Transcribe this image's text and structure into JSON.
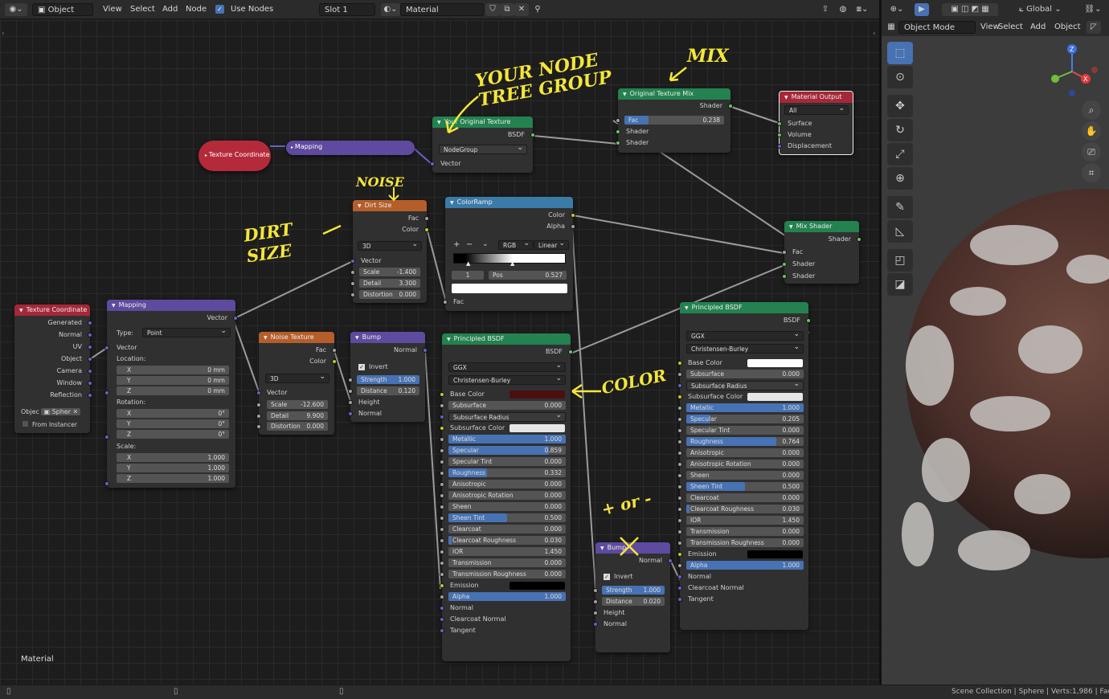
{
  "topbar": {
    "mode": "Object",
    "menus": [
      "View",
      "Select",
      "Add",
      "Node"
    ],
    "use_nodes_label": "Use Nodes",
    "slot": "Slot 1",
    "material": "Material"
  },
  "viewport_topbar": {
    "orientation": "Global"
  },
  "viewport_header": {
    "mode": "Object Mode",
    "menus": [
      "View",
      "Select",
      "Add",
      "Object"
    ]
  },
  "editor": {
    "material_label": "Material"
  },
  "status": {
    "text": "Scene Collection | Sphere | Verts:1,986 | Face"
  },
  "annotations": {
    "group": "YOUR NODE TREE GROUP",
    "mix": "MIX",
    "noise": "NOISE",
    "dirt": "DIRT SIZE",
    "color": "COLOR",
    "plusminus": "+ or -"
  },
  "nodes": {
    "tex_coord_collapsed": {
      "title": "Texture Coordinate"
    },
    "mapping_collapsed": {
      "title": "Mapping"
    },
    "your_texture": {
      "title": "Your Original Texture",
      "out": "BSDF",
      "group": "NodeGroup",
      "in": "Vector"
    },
    "orig_mix": {
      "title": "Original Texture Mix",
      "out": "Shader",
      "fac_label": "Fac",
      "fac": "0.238",
      "in1": "Shader",
      "in2": "Shader"
    },
    "mat_output": {
      "title": "Material Output",
      "target": "All",
      "in": [
        "Surface",
        "Volume",
        "Displacement"
      ]
    },
    "dirt_size": {
      "title": "Dirt Size",
      "outs": [
        "Fac",
        "Color"
      ],
      "dim": "3D",
      "vector": "Vector",
      "scale": "-1.400",
      "detail": "3.300",
      "distortion": "0.000",
      "scale_l": "Scale",
      "detail_l": "Detail",
      "distortion_l": "Distortion"
    },
    "colorramp": {
      "title": "ColorRamp",
      "outs": [
        "Color",
        "Alpha"
      ],
      "mode": "RGB",
      "interp": "Linear",
      "index": "1",
      "pos_label": "Pos",
      "pos": "0.527",
      "in": "Fac",
      "plus": "+",
      "minus": "−"
    },
    "mix_shader": {
      "title": "Mix Shader",
      "out": "Shader",
      "ins": [
        "Fac",
        "Shader",
        "Shader"
      ]
    },
    "tex_coord": {
      "title": "Texture Coordinate",
      "outs": [
        "Generated",
        "Normal",
        "UV",
        "Object",
        "Camera",
        "Window",
        "Reflection"
      ],
      "object_label": "Objec",
      "object_value": "Spher",
      "instancer": "From Instancer"
    },
    "mapping": {
      "title": "Mapping",
      "out": "Vector",
      "type_label": "Type:",
      "type": "Point",
      "vector": "Vector",
      "location": "Location:",
      "loc": [
        "0 mm",
        "0 mm",
        "0 mm"
      ],
      "rotation": "Rotation:",
      "rot": [
        "0°",
        "0°",
        "0°"
      ],
      "scale": "Scale:",
      "scl": [
        "1.000",
        "1.000",
        "1.000"
      ],
      "axes": [
        "X",
        "Y",
        "Z"
      ]
    },
    "noise": {
      "title": "Noise Texture",
      "outs": [
        "Fac",
        "Color"
      ],
      "dim": "3D",
      "vector": "Vector",
      "scale": "-12.600",
      "detail": "9.900",
      "distortion": "0.000"
    },
    "bump1": {
      "title": "Bump",
      "out": "Normal",
      "invert": "Invert",
      "strength": "1.000",
      "distance": "0.120",
      "strength_l": "Strength",
      "distance_l": "Distance",
      "height": "Height",
      "normal": "Normal"
    },
    "bump2": {
      "title": "Bump",
      "out": "Normal",
      "invert": "Invert",
      "strength": "1.000",
      "distance": "0.020",
      "height": "Height",
      "normal": "Normal"
    },
    "bsdf1": {
      "title": "Principled BSDF",
      "out": "BSDF",
      "dist": "GGX",
      "sss": "Christensen-Burley",
      "rows": [
        {
          "label": "Base Color",
          "type": "color",
          "color": "#4a1010"
        },
        {
          "label": "Subsurface",
          "value": "0.000"
        },
        {
          "label": "Subsurface Radius",
          "type": "select"
        },
        {
          "label": "Subsurface Color",
          "type": "color",
          "color": "#e6e6e6"
        },
        {
          "label": "Metallic",
          "value": "1.000",
          "fill": 1.0
        },
        {
          "label": "Specular",
          "value": "0.859",
          "fill": 0.859
        },
        {
          "label": "Specular Tint",
          "value": "0.000"
        },
        {
          "label": "Roughness",
          "value": "0.332",
          "fill": 0.332
        },
        {
          "label": "Anisotropic",
          "value": "0.000"
        },
        {
          "label": "Anisotropic Rotation",
          "value": "0.000"
        },
        {
          "label": "Sheen",
          "value": "0.000"
        },
        {
          "label": "Sheen Tint",
          "value": "0.500",
          "fill": 0.5
        },
        {
          "label": "Clearcoat",
          "value": "0.000"
        },
        {
          "label": "Clearcoat Roughness",
          "value": "0.030",
          "fill": 0.03
        },
        {
          "label": "IOR",
          "value": "1.450"
        },
        {
          "label": "Transmission",
          "value": "0.000"
        },
        {
          "label": "Transmission Roughness",
          "value": "0.000"
        },
        {
          "label": "Emission",
          "type": "color",
          "color": "#000000"
        },
        {
          "label": "Alpha",
          "value": "1.000",
          "fill": 1.0
        },
        {
          "label": "Normal",
          "type": "socket"
        },
        {
          "label": "Clearcoat Normal",
          "type": "socket"
        },
        {
          "label": "Tangent",
          "type": "socket"
        }
      ]
    },
    "bsdf2": {
      "title": "Principled BSDF",
      "out": "BSDF",
      "dist": "GGX",
      "sss": "Christensen-Burley",
      "rows": [
        {
          "label": "Base Color",
          "type": "color",
          "color": "#ffffff"
        },
        {
          "label": "Subsurface",
          "value": "0.000"
        },
        {
          "label": "Subsurface Radius",
          "type": "select"
        },
        {
          "label": "Subsurface Color",
          "type": "color",
          "color": "#e6e6e6"
        },
        {
          "label": "Metallic",
          "value": "1.000",
          "fill": 1.0
        },
        {
          "label": "Specular",
          "value": "0.205",
          "fill": 0.205
        },
        {
          "label": "Specular Tint",
          "value": "0.000"
        },
        {
          "label": "Roughness",
          "value": "0.764",
          "fill": 0.764
        },
        {
          "label": "Anisotropic",
          "value": "0.000"
        },
        {
          "label": "Anisotropic Rotation",
          "value": "0.000"
        },
        {
          "label": "Sheen",
          "value": "0.000"
        },
        {
          "label": "Sheen Tint",
          "value": "0.500",
          "fill": 0.5
        },
        {
          "label": "Clearcoat",
          "value": "0.000"
        },
        {
          "label": "Clearcoat Roughness",
          "value": "0.030",
          "fill": 0.03
        },
        {
          "label": "IOR",
          "value": "1.450"
        },
        {
          "label": "Transmission",
          "value": "0.000"
        },
        {
          "label": "Transmission Roughness",
          "value": "0.000"
        },
        {
          "label": "Emission",
          "type": "color",
          "color": "#000000"
        },
        {
          "label": "Alpha",
          "value": "1.000",
          "fill": 1.0
        },
        {
          "label": "Normal",
          "type": "socket"
        },
        {
          "label": "Clearcoat Normal",
          "type": "socket"
        },
        {
          "label": "Tangent",
          "type": "socket"
        }
      ]
    }
  }
}
